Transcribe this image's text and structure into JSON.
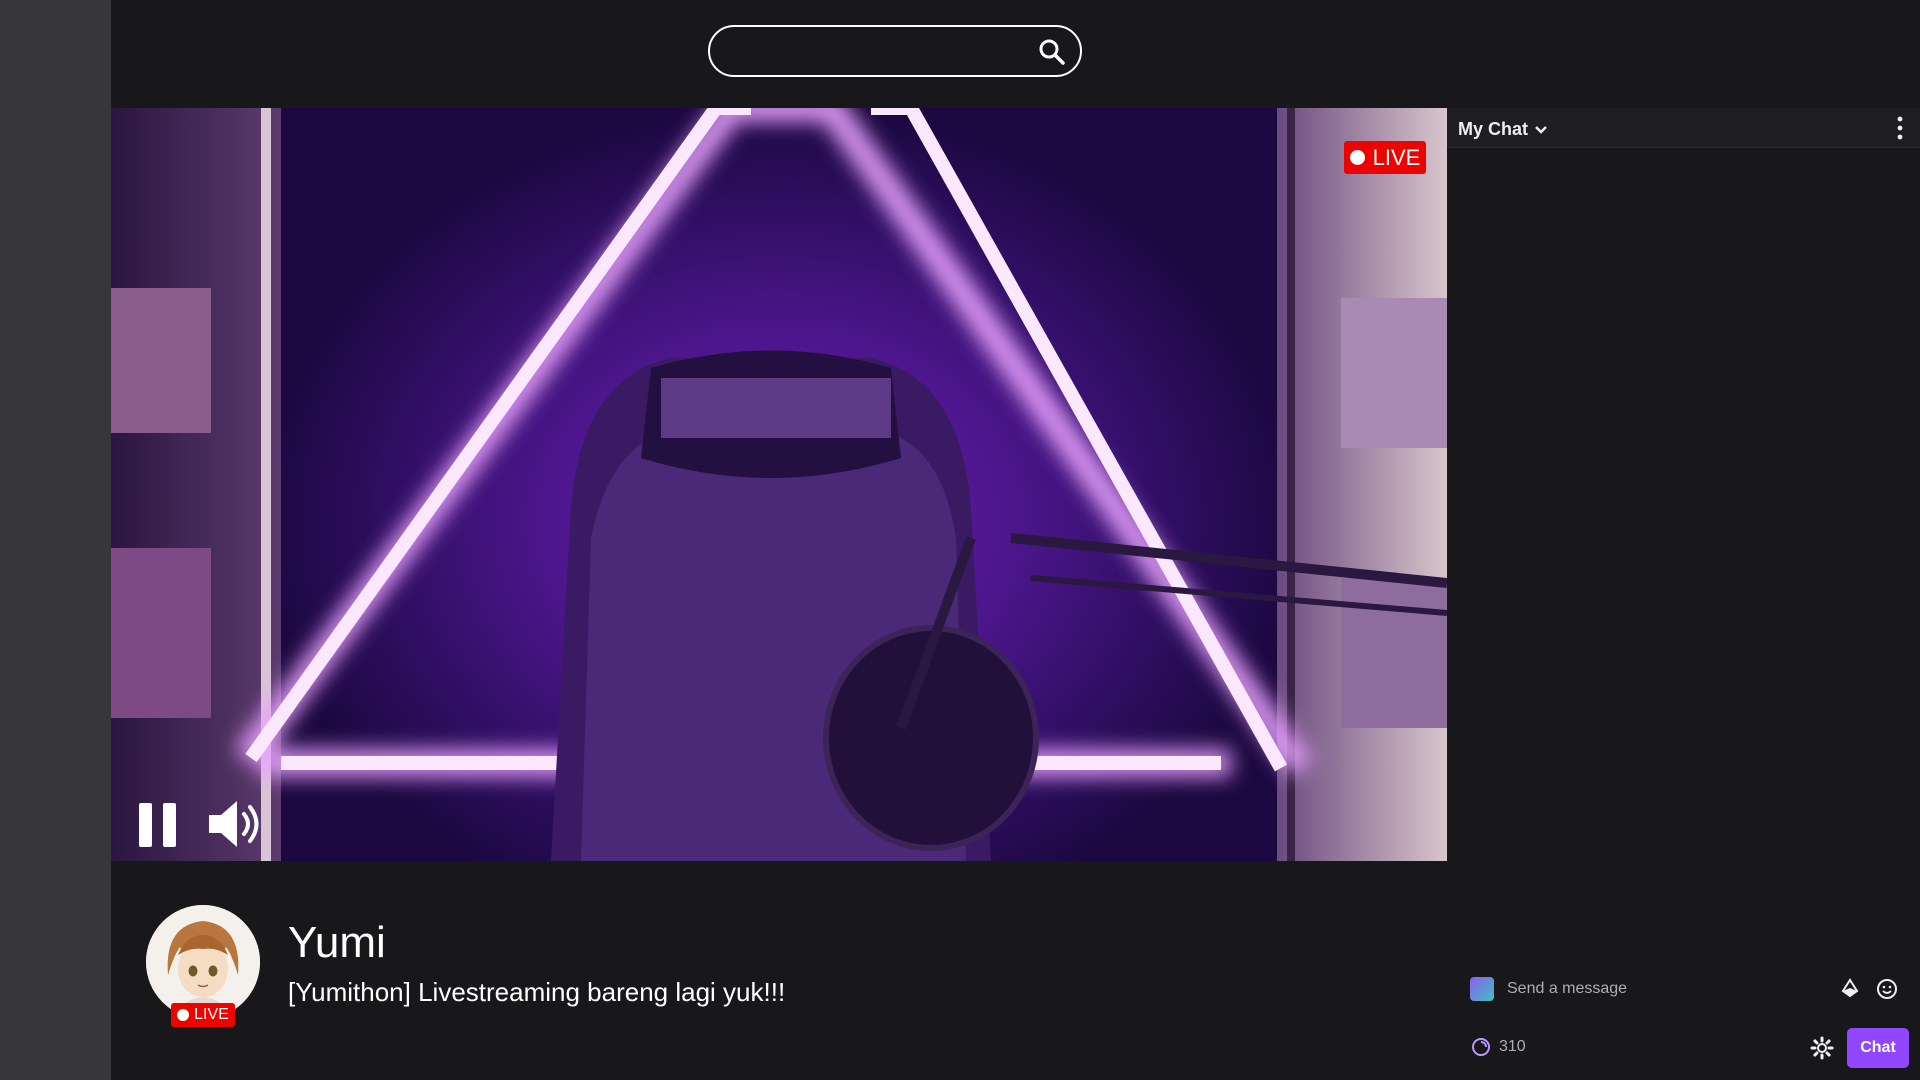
{
  "search": {
    "placeholder": "",
    "icon": "search-icon"
  },
  "player": {
    "live_label": "LIVE",
    "controls": {
      "pause_icon": "pause-icon",
      "volume_icon": "volume-icon"
    }
  },
  "chat": {
    "title": "My Chat",
    "input_placeholder": "Send a message",
    "points": "310",
    "send_label": "Chat"
  },
  "streamer": {
    "name": "Yumi",
    "title": "[Yumithon] Livestreaming bareng lagi yuk!!!",
    "live_label": "LIVE"
  },
  "colors": {
    "accent": "#9147ff",
    "live": "#eb0400",
    "background": "#18181b",
    "rail": "#37373b"
  }
}
